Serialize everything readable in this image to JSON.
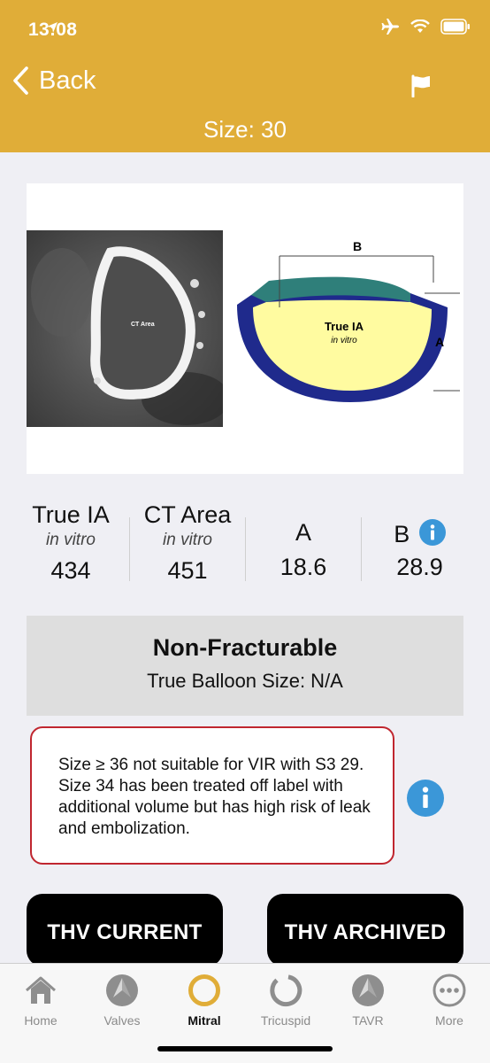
{
  "status_bar": {
    "time": "13:08"
  },
  "nav": {
    "back_label": "Back",
    "title": "Size: 30"
  },
  "image": {
    "ct_label": "CT Area",
    "diagram_label_b": "B",
    "diagram_label_a": "A",
    "diagram_true_ia": "True IA",
    "diagram_in_vitro": "in vitro"
  },
  "metrics": {
    "true_ia": {
      "label": "True IA",
      "sub": "in vitro",
      "value": "434"
    },
    "ct_area": {
      "label": "CT Area",
      "sub": "in vitro",
      "value": "451"
    },
    "a": {
      "label": "A",
      "value": "18.6"
    },
    "b": {
      "label": "B",
      "value": "28.9"
    }
  },
  "fracture": {
    "title": "Non-Fracturable",
    "balloon": "True Balloon Size: N/A"
  },
  "warning": {
    "text": "Size ≥ 36 not suitable for VIR with S3 29. Size 34 has been treated off label with additional volume but has high risk of leak and embolization."
  },
  "buttons": {
    "current": "THV CURRENT",
    "archived": "THV ARCHIVED"
  },
  "tabs": [
    {
      "label": "Home"
    },
    {
      "label": "Valves"
    },
    {
      "label": "Mitral"
    },
    {
      "label": "Tricuspid"
    },
    {
      "label": "TAVR"
    },
    {
      "label": "More"
    }
  ],
  "colors": {
    "header": "#e0ad38",
    "info": "#3b97d8",
    "warning_border": "#c0262f",
    "active_tab": "#e0ad38"
  }
}
